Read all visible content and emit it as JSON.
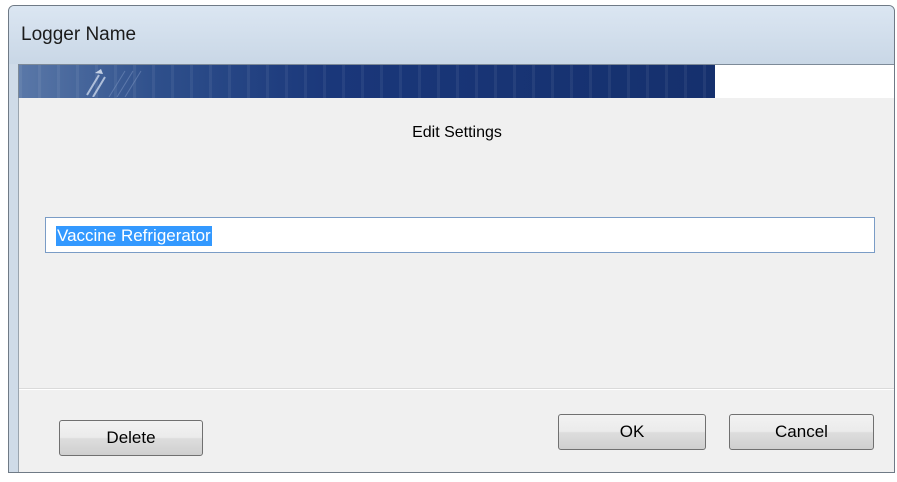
{
  "window": {
    "title": "Logger Name"
  },
  "banner": {
    "image": "logo-banner"
  },
  "dialog": {
    "heading": "Edit Settings",
    "name_field": {
      "value": "Vaccine Refrigerator",
      "selected": true
    }
  },
  "buttons": {
    "delete_label": "Delete",
    "ok_label": "OK",
    "cancel_label": "Cancel"
  },
  "colors": {
    "title_bar": "#cfdbe8",
    "banner_blue": "#15306d",
    "selection": "#3399ff",
    "dialog_bg": "#f0f0f0"
  }
}
